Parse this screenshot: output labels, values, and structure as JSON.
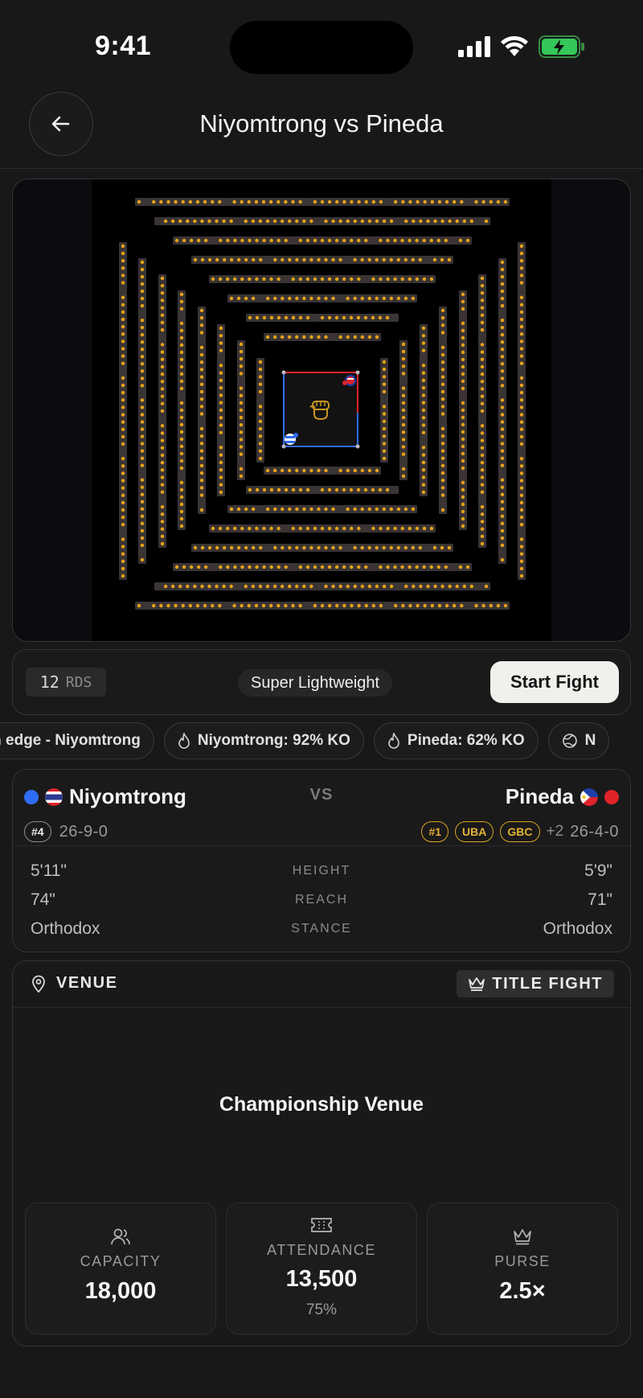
{
  "status_bar": {
    "time": "9:41"
  },
  "header": {
    "title": "Niyomtrong vs Pineda"
  },
  "controls": {
    "rounds_value": "12",
    "rounds_unit": "RDS",
    "weight_class": "Super Lightweight",
    "start_label": "Start Fight"
  },
  "chips": [
    {
      "icon": "none",
      "label": "ach edge - Niyomtrong"
    },
    {
      "icon": "flame-icon",
      "label": "Niyomtrong: 92% KO"
    },
    {
      "icon": "flame-icon",
      "label": "Pineda: 62% KO"
    },
    {
      "icon": "globe-icon",
      "label": "N"
    }
  ],
  "matchup": {
    "vs_label": "VS",
    "left": {
      "name": "Niyomtrong",
      "corner_color": "#2f6cf5",
      "country_flag": "Thailand",
      "rank": "#4",
      "record": "26-9-0"
    },
    "right": {
      "name": "Pineda",
      "corner_color": "#e0242a",
      "country_flag": "Philippines",
      "badges": [
        "#1",
        "UBA",
        "GBC"
      ],
      "more": "+2",
      "record": "26-4-0"
    },
    "stats": [
      {
        "label": "HEIGHT",
        "left": "5'11\"",
        "right": "5'9\""
      },
      {
        "label": "REACH",
        "left": "74\"",
        "right": "71\""
      },
      {
        "label": "STANCE",
        "left": "Orthodox",
        "right": "Orthodox"
      }
    ]
  },
  "venue": {
    "section_label": "VENUE",
    "title_badge": "TITLE FIGHT",
    "name": "Championship Venue",
    "metrics": [
      {
        "icon": "users-icon",
        "label": "CAPACITY",
        "value": "18,000",
        "sub": ""
      },
      {
        "icon": "ticket-icon",
        "label": "ATTENDANCE",
        "value": "13,500",
        "sub": "75%"
      },
      {
        "icon": "crown-icon",
        "label": "PURSE",
        "value": "2.5×",
        "sub": ""
      }
    ]
  },
  "colors": {
    "background": "#181818",
    "card": "#1a1a1a",
    "gold": "#e5b235",
    "blue_corner": "#2f6cf5",
    "red_corner": "#e0242a",
    "seat_light": "#e8a318"
  }
}
